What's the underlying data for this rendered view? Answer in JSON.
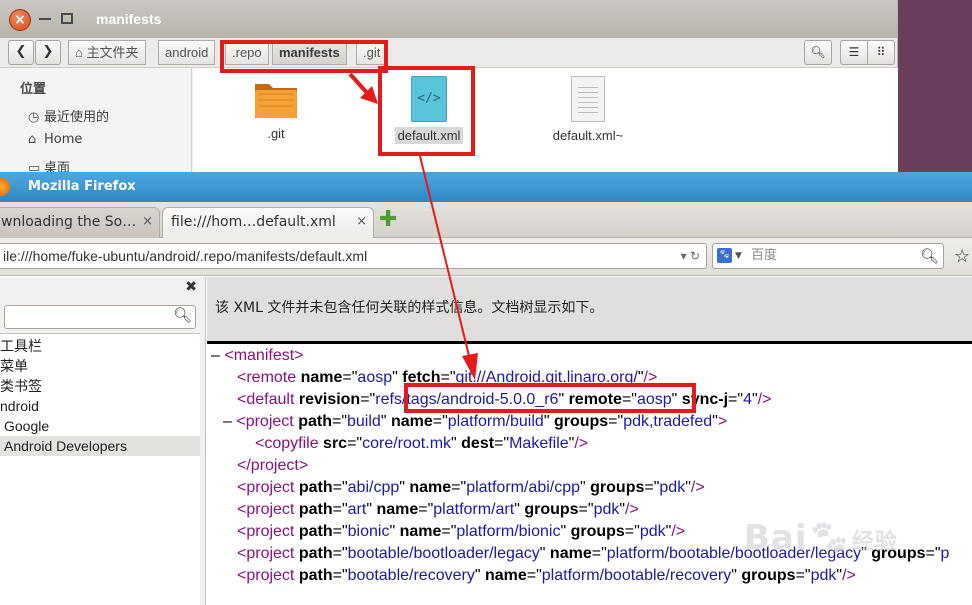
{
  "file_manager": {
    "title": "manifests",
    "breadcrumbs": [
      "主文件夹",
      "android",
      ".repo",
      "manifests",
      ".git"
    ],
    "sidebar": {
      "heading": "位置",
      "items": [
        {
          "label": "最近使用的",
          "icon": "clock-icon"
        },
        {
          "label": "Home",
          "icon": "home-icon"
        },
        {
          "label": "桌面",
          "icon": "desktop-icon"
        }
      ]
    },
    "files": [
      {
        "name": ".git",
        "icon": "folder-icon"
      },
      {
        "name": "default.xml",
        "icon": "xml-file-icon",
        "selected": true
      },
      {
        "name": "default.xml~",
        "icon": "text-file-icon"
      }
    ]
  },
  "firefox": {
    "window_title": "Mozilla Firefox",
    "tabs": [
      {
        "label": "wnloading the So…"
      },
      {
        "label": "file:///hom…default.xml"
      }
    ],
    "url": "ile:///home/fuke-ubuntu/android/.repo/manifests/default.xml",
    "search_placeholder": "百度",
    "sidebar": {
      "items": [
        "工具栏",
        "菜单",
        "类书签",
        "ndroid",
        "Google",
        "Android Developers"
      ]
    },
    "xml_info": "该 XML 文件并未包含任何关联的样式信息。文档树显示如下。"
  },
  "xml": {
    "manifest_open": "manifest",
    "manifest_toggle": "–",
    "remote": {
      "tag": "remote",
      "name_attr": "name",
      "name_val": "aosp",
      "fetch_attr": "fetch",
      "fetch_val": "git://Android.git.linaro.org/"
    },
    "default": {
      "tag": "default",
      "rev_attr": "revision",
      "rev_val": "refs/tags/android-5.0.0_r6",
      "remote_attr": "remote",
      "remote_val": "aosp",
      "sync_attr": "sync-j",
      "sync_val": "4"
    },
    "projects": [
      {
        "path": "build",
        "name": "platform/build",
        "groups": "pdk,tradefed",
        "expanded": true,
        "child": {
          "tag": "copyfile",
          "src": "core/root.mk",
          "dest": "Makefile"
        }
      },
      {
        "path": "abi/cpp",
        "name": "platform/abi/cpp",
        "groups": "pdk"
      },
      {
        "path": "art",
        "name": "platform/art",
        "groups": "pdk"
      },
      {
        "path": "bionic",
        "name": "platform/bionic",
        "groups": "pdk"
      },
      {
        "path": "bootable/bootloader/legacy",
        "name": "platform/bootable/bootloader/legacy",
        "groups": "p"
      },
      {
        "path": "bootable/recovery",
        "name": "platform/bootable/recovery",
        "groups": "pdk"
      }
    ]
  },
  "watermark": {
    "text": "Bai",
    "suffix": "经验"
  },
  "colors": {
    "annotation": "#e41b1b",
    "titlebar": "#2f88c5",
    "tag": "#881280",
    "attr_value": "#1a1aa6"
  }
}
